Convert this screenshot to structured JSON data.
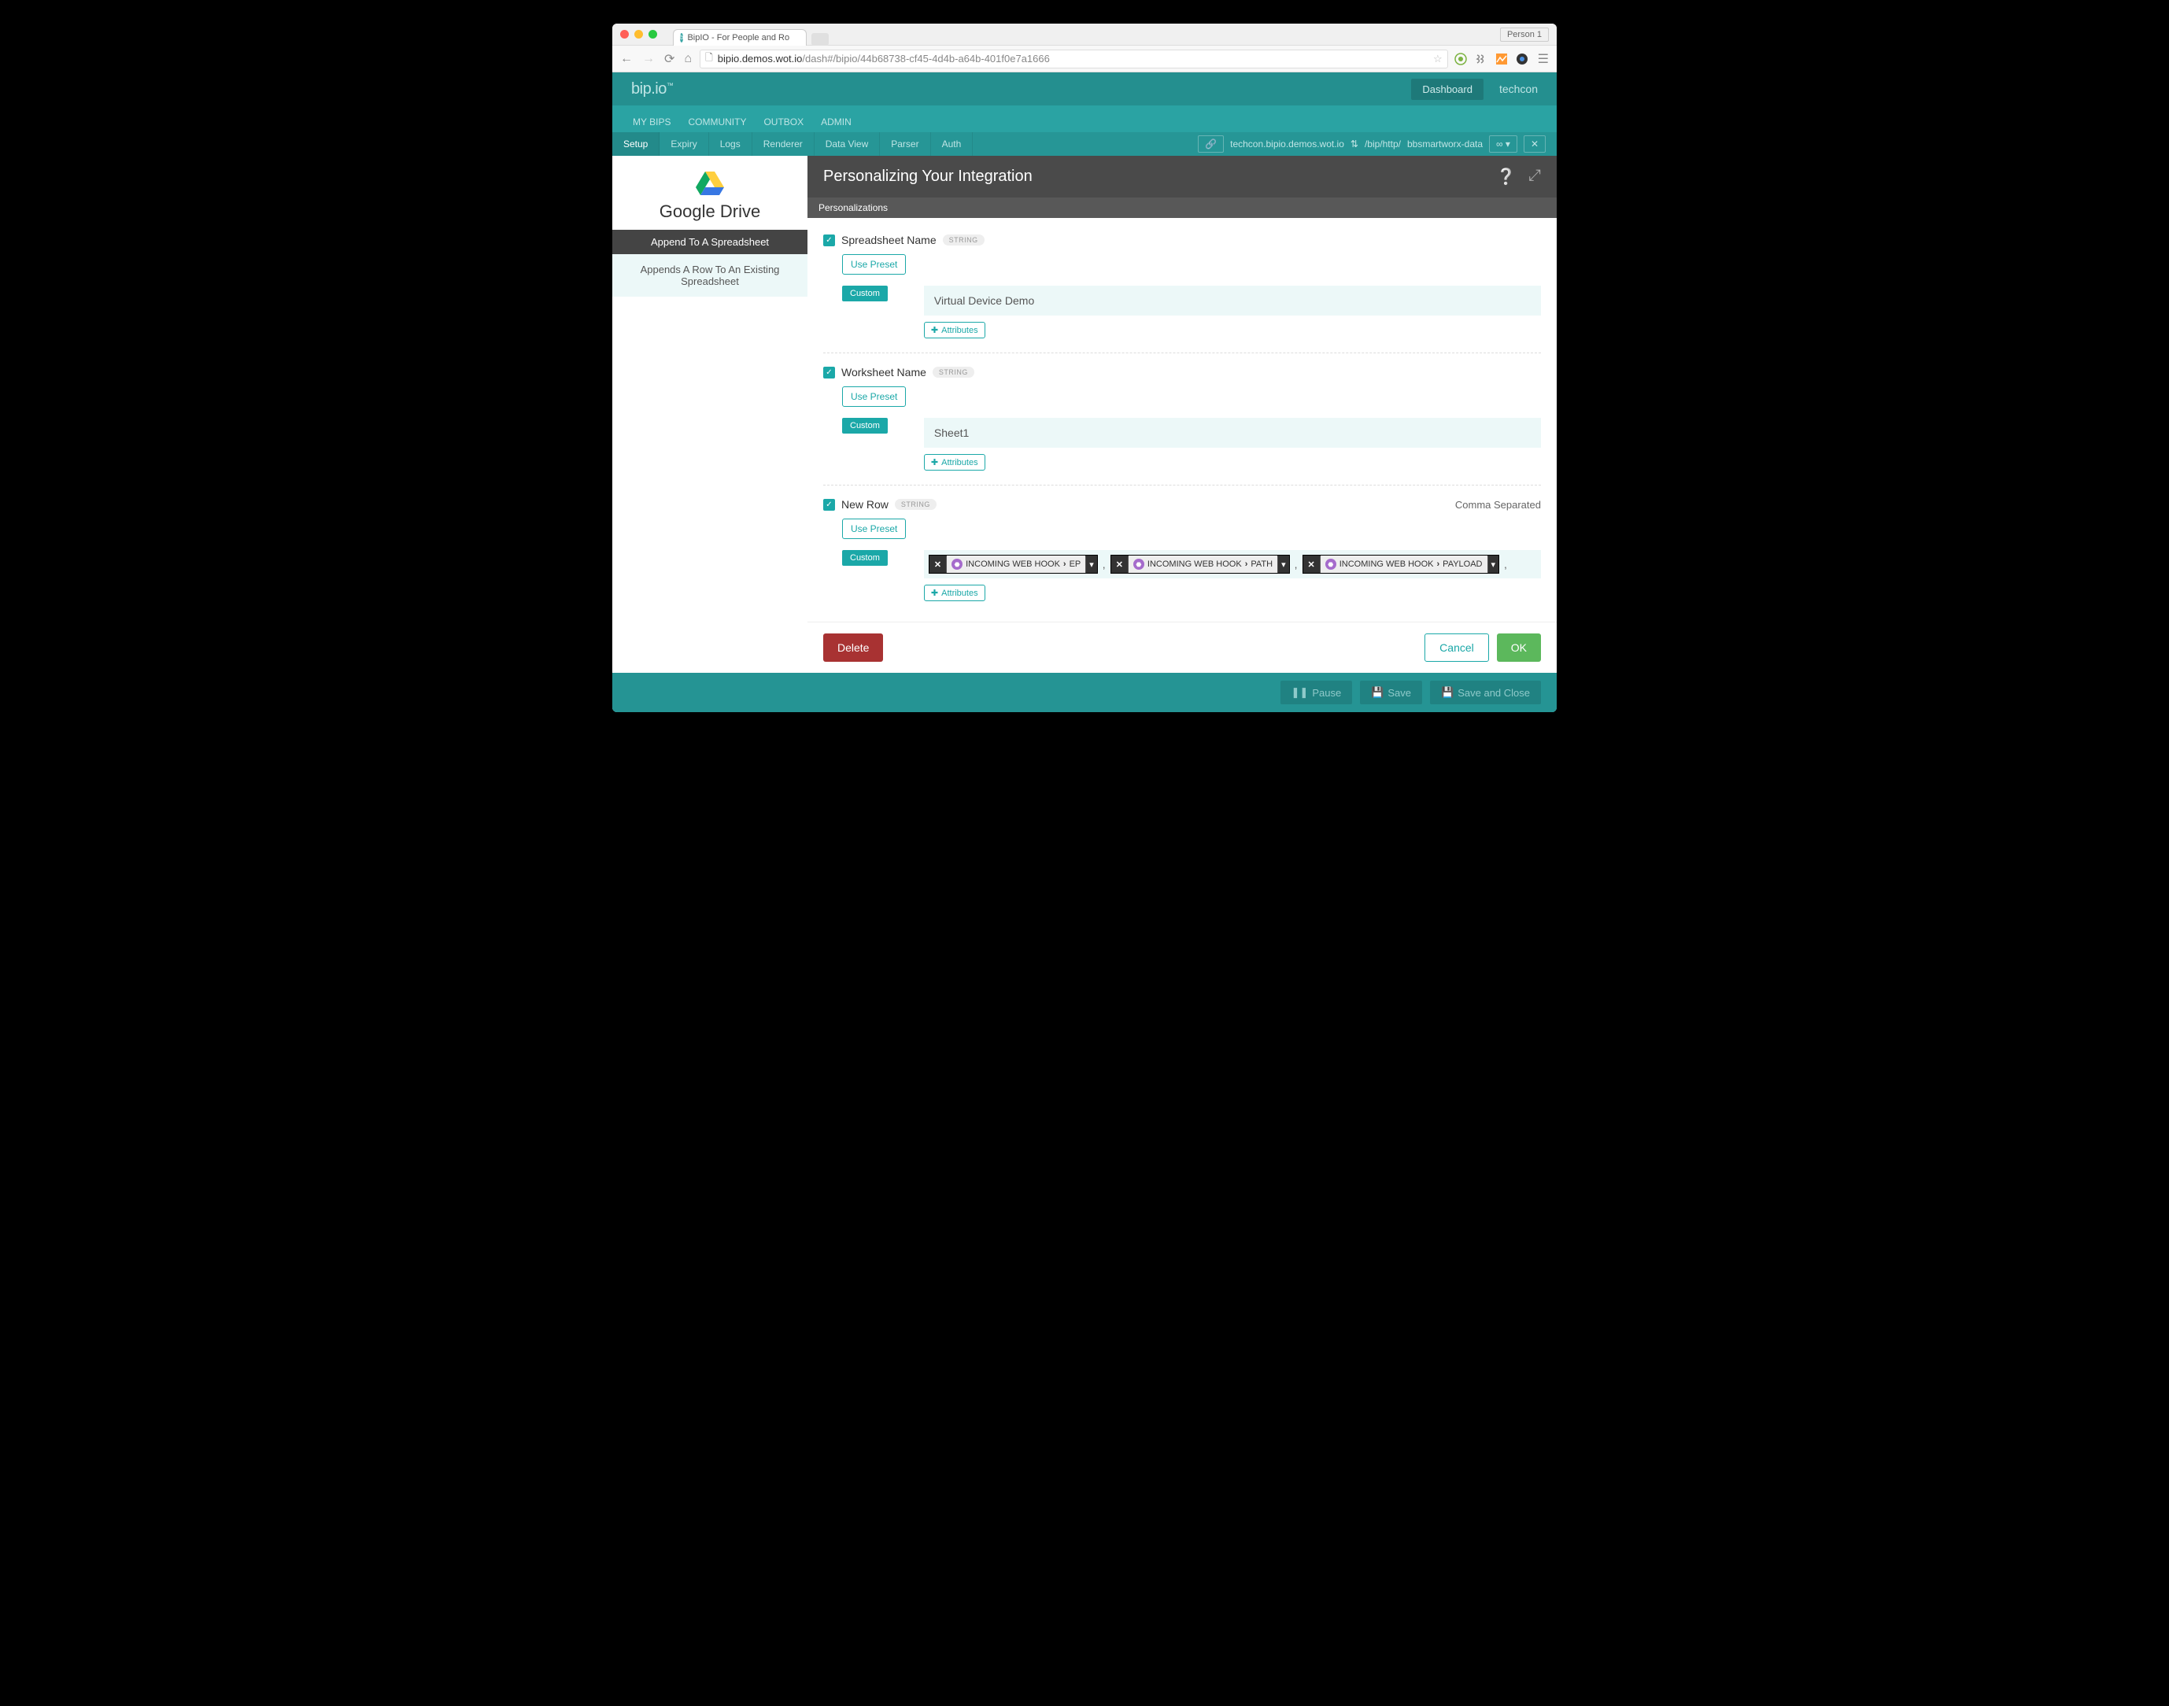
{
  "browser": {
    "tab_title": "BipIO - For People and Ro",
    "person": "Person 1",
    "url_host": "bipio.demos.wot.io",
    "url_path": "/dash#/bipio/44b68738-cf45-4d4b-a64b-401f0e7a1666"
  },
  "header": {
    "logo": "bip.io",
    "dashboard": "Dashboard",
    "user": "techcon"
  },
  "subnav": [
    "MY BIPS",
    "COMMUNITY",
    "OUTBOX",
    "ADMIN"
  ],
  "tabs": [
    "Setup",
    "Expiry",
    "Logs",
    "Renderer",
    "Data View",
    "Parser",
    "Auth"
  ],
  "urlbar": {
    "domain": "techcon.bipio.demos.wot.io",
    "path_prefix": "/bip/http/",
    "name": "bbsmartworx-data"
  },
  "sidebar": {
    "pod": "Google Drive",
    "action": "Append To A Spreadsheet",
    "desc": "Appends A Row To An Existing Spreadsheet"
  },
  "panel": {
    "title": "Personalizing Your Integration",
    "subtab": "Personalizations"
  },
  "fields": {
    "spreadsheet": {
      "label": "Spreadsheet Name",
      "type": "STRING",
      "preset": "Use Preset",
      "custom": "Custom",
      "value": "Virtual Device Demo",
      "attributes": "Attributes"
    },
    "worksheet": {
      "label": "Worksheet Name",
      "type": "STRING",
      "preset": "Use Preset",
      "custom": "Custom",
      "value": "Sheet1",
      "attributes": "Attributes"
    },
    "newrow": {
      "label": "New Row",
      "type": "STRING",
      "hint": "Comma Separated",
      "preset": "Use Preset",
      "custom": "Custom",
      "attributes": "Attributes",
      "tokens": {
        "src": "INCOMING WEB HOOK",
        "t1": "EP",
        "t2": "PATH",
        "t3": "PAYLOAD"
      }
    }
  },
  "footer": {
    "delete": "Delete",
    "cancel": "Cancel",
    "ok": "OK"
  },
  "bottom": {
    "pause": "Pause",
    "save": "Save",
    "save_close": "Save and Close"
  }
}
